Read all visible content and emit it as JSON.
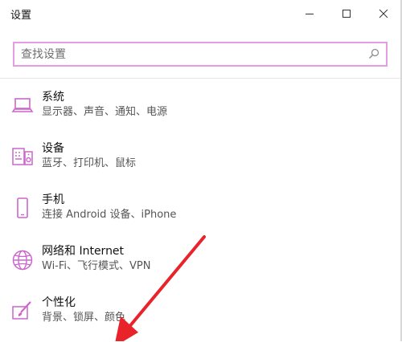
{
  "window": {
    "title": "设置",
    "minimize_icon": "minimize-icon",
    "maximize_icon": "maximize-icon",
    "close_icon": "close-icon"
  },
  "search": {
    "placeholder": "查找设置",
    "value": "",
    "icon": "search-icon",
    "border_color": "#e69ce0"
  },
  "accent_color": "#cc66cc",
  "categories": [
    {
      "label": "系统",
      "description": "显示器、声音、通知、电源",
      "icon": "laptop-icon"
    },
    {
      "label": "设备",
      "description": "蓝牙、打印机、鼠标",
      "icon": "keyboard-devices-icon"
    },
    {
      "label": "手机",
      "description": "连接 Android 设备、iPhone",
      "icon": "phone-icon"
    },
    {
      "label": "网络和 Internet",
      "description": "Wi-Fi、飞行模式、VPN",
      "icon": "globe-icon"
    },
    {
      "label": "个性化",
      "description": "背景、锁屏、颜色",
      "icon": "paintbrush-icon"
    }
  ],
  "annotation": {
    "shape": "red-arrow",
    "color": "#e8242a"
  }
}
